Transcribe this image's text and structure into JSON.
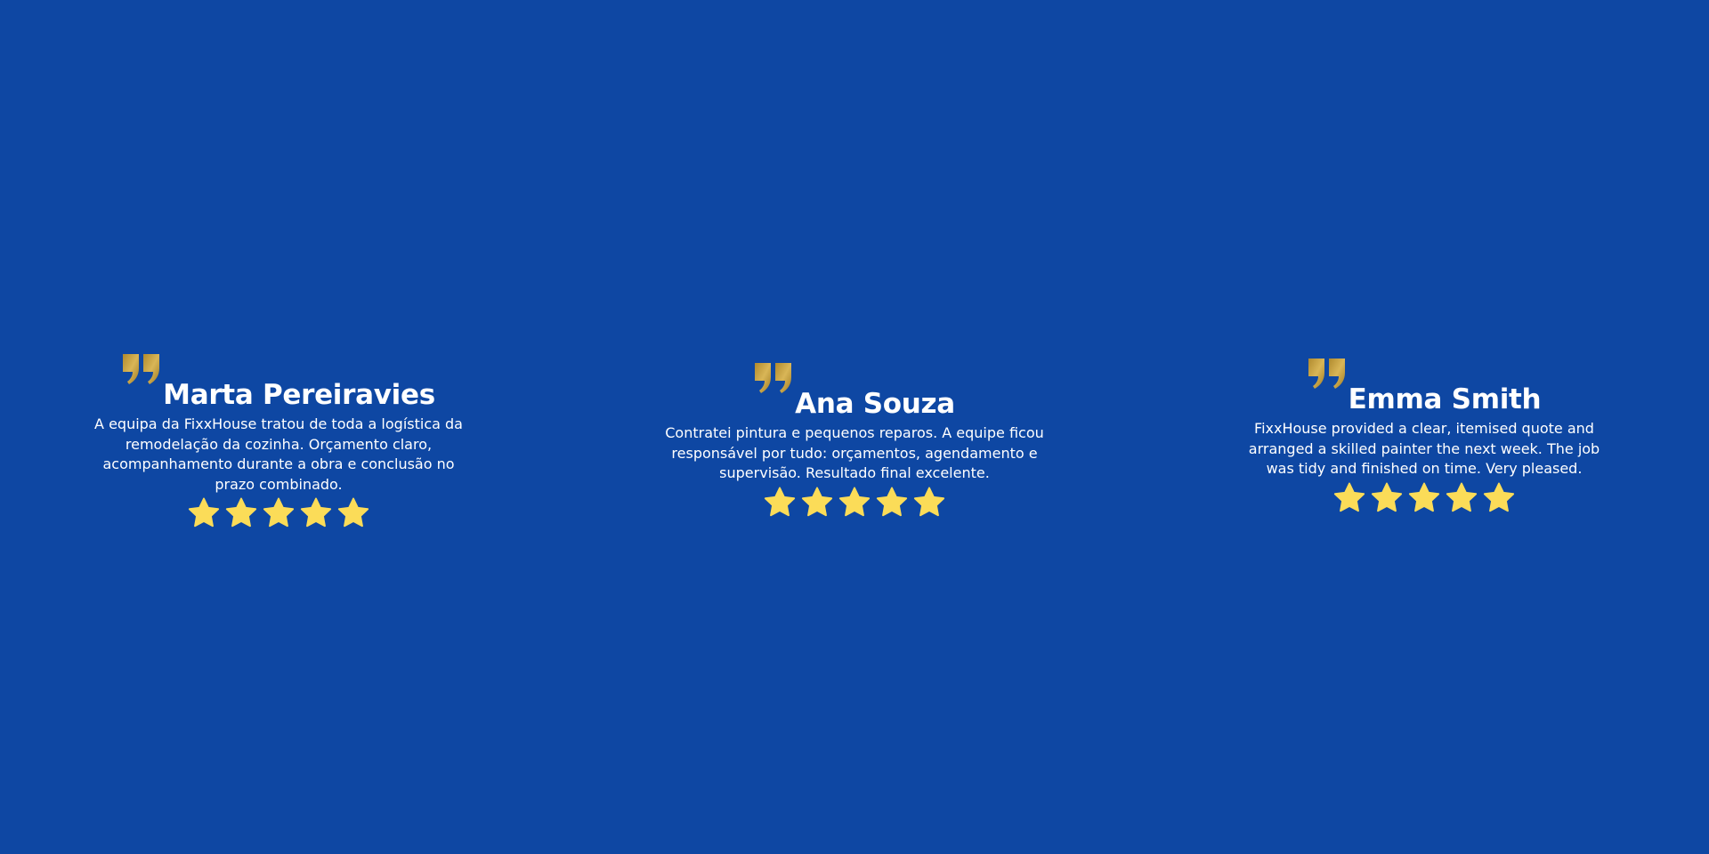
{
  "colors": {
    "background": "#0e47a3",
    "quote_gold": "#c9a23d",
    "star_yellow": "#fbdc58",
    "text": "#ffffff"
  },
  "testimonials": [
    {
      "name": "Marta Pereiravies",
      "text": "A equipa da FixxHouse tratou de toda a logística da remodelação da cozinha. Orçamento claro, acompanhamento durante a obra e conclusão no prazo combinado.",
      "rating": 5
    },
    {
      "name": "Ana Souza",
      "text": "Contratei pintura e pequenos reparos. A equipe ficou responsável por tudo: orçamentos, agendamento e supervisão. Resultado final excelente.",
      "rating": 5
    },
    {
      "name": "Emma Smith",
      "text": "FixxHouse provided a clear, itemised quote and arranged a skilled painter the next week. The job was tidy and finished on time. Very pleased.",
      "rating": 5
    }
  ],
  "icons": {
    "quote": "quote-icon",
    "star": "star-icon"
  }
}
